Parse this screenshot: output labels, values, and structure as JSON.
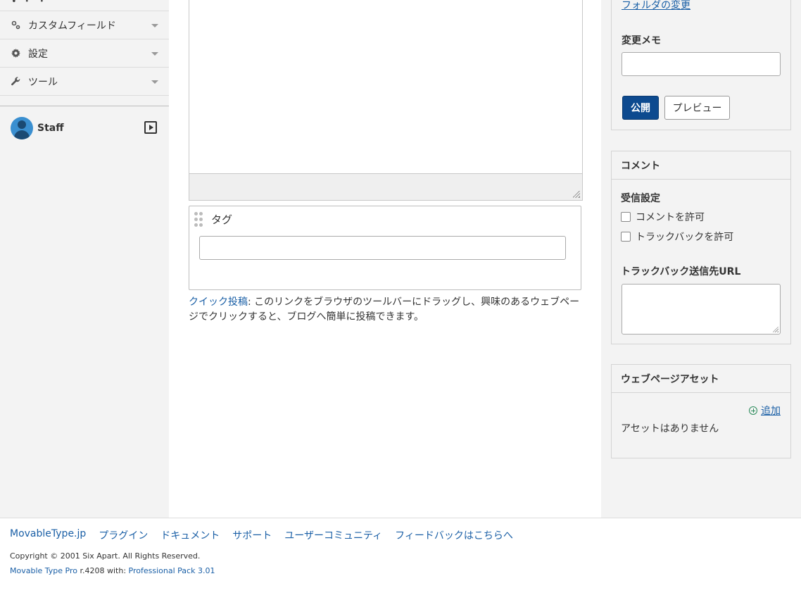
{
  "sidebar": {
    "items": [
      {
        "label": "カスタムフィールド",
        "icon": "custom-field-icon"
      },
      {
        "label": "設定",
        "icon": "gear-icon"
      },
      {
        "label": "ツール",
        "icon": "wrench-icon"
      }
    ],
    "user": {
      "name": "Staff"
    }
  },
  "main": {
    "tag_panel": {
      "title": "タグ",
      "value": ""
    },
    "quickpost": {
      "link": "クイック投稿",
      "text": ": このリンクをブラウザのツールバーにドラッグし、興味のあるウェブページでクリックすると、ブログへ簡単に投稿できます。"
    }
  },
  "right": {
    "publish_panel": {
      "folder_link": "フォルダの変更",
      "memo_label": "変更メモ",
      "memo_value": "",
      "publish_label": "公開",
      "preview_label": "プレビュー"
    },
    "comment_panel": {
      "title": "コメント",
      "receive_label": "受信設定",
      "allow_comments": {
        "label": "コメントを許可",
        "checked": false
      },
      "allow_trackbacks": {
        "label": "トラックバックを許可",
        "checked": false
      },
      "trackback_url_label": "トラックバック送信先URL"
    },
    "asset_panel": {
      "title": "ウェブページアセット",
      "add_label": "追加",
      "empty_text": "アセットはありません"
    }
  },
  "footer": {
    "links": [
      "MovableType.jp",
      "プラグイン",
      "ドキュメント",
      "サポート",
      "ユーザーコミュニティ",
      "フィードバックはこちらへ"
    ],
    "copyright": "Copyright © 2001 Six Apart. All Rights Reserved.",
    "version_product": "Movable Type Pro",
    "version_text": " r.4208 with: ",
    "version_pack": "Professional Pack 3.01"
  },
  "colors": {
    "accent": "#0d4a8f",
    "link": "#1a5fa6",
    "sidebar_bg": "#f3f3f3"
  }
}
